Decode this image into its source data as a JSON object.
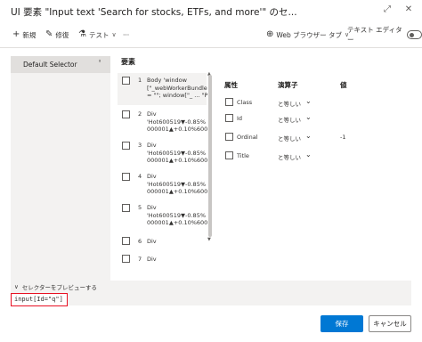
{
  "window": {
    "title": "UI 要素 \"Input text 'Search for stocks, ETFs, and more'\" のセ...",
    "maximize_icon": "⤢",
    "close_icon": "✕"
  },
  "toolbar": {
    "new_label": "新規",
    "edit_label": "修復",
    "test_label": "テスト",
    "more_label": "···",
    "browser_label": "Web ブラウザー タブ",
    "text_editor_label": "テキスト エディター"
  },
  "left_panel": {
    "default_selector_label": "Default Selector"
  },
  "elements": {
    "heading": "要素",
    "items": [
      {
        "num": "1",
        "text": "Body 'window\n[\"_webWorkerBundle\"]\n= \"\"; window[\"_ ... \"Pu..."
      },
      {
        "num": "2",
        "text": "Div\n'Hot600519▼-0.85%\n000001▲+0.10%6005..."
      },
      {
        "num": "3",
        "text": "Div\n'Hot600519▼-0.85%\n000001▲+0.10%6005..."
      },
      {
        "num": "4",
        "text": "Div\n'Hot600519▼-0.85%\n000001▲+0.10%6005..."
      },
      {
        "num": "5",
        "text": "Div\n'Hot600519▼-0.85%\n000001▲+0.10%600..."
      },
      {
        "num": "6",
        "text": "Div"
      },
      {
        "num": "7",
        "text": "Div"
      }
    ]
  },
  "attributes": {
    "col_attr": "属性",
    "col_op": "演算子",
    "col_val": "値",
    "rows": [
      {
        "name": "Class",
        "op": "と等しい",
        "value": ""
      },
      {
        "name": "Id",
        "op": "と等しい",
        "value": ""
      },
      {
        "name": "Ordinal",
        "op": "と等しい",
        "value": "-1"
      },
      {
        "name": "Title",
        "op": "と等しい",
        "value": ""
      }
    ]
  },
  "preview": {
    "toggle_label": "セレクターをプレビューする",
    "code": "input[Id=\"q\"]"
  },
  "footer": {
    "save_label": "保存",
    "cancel_label": "キャンセル"
  },
  "colors": {
    "accent": "#0078d4",
    "highlight_border": "#e81123"
  }
}
